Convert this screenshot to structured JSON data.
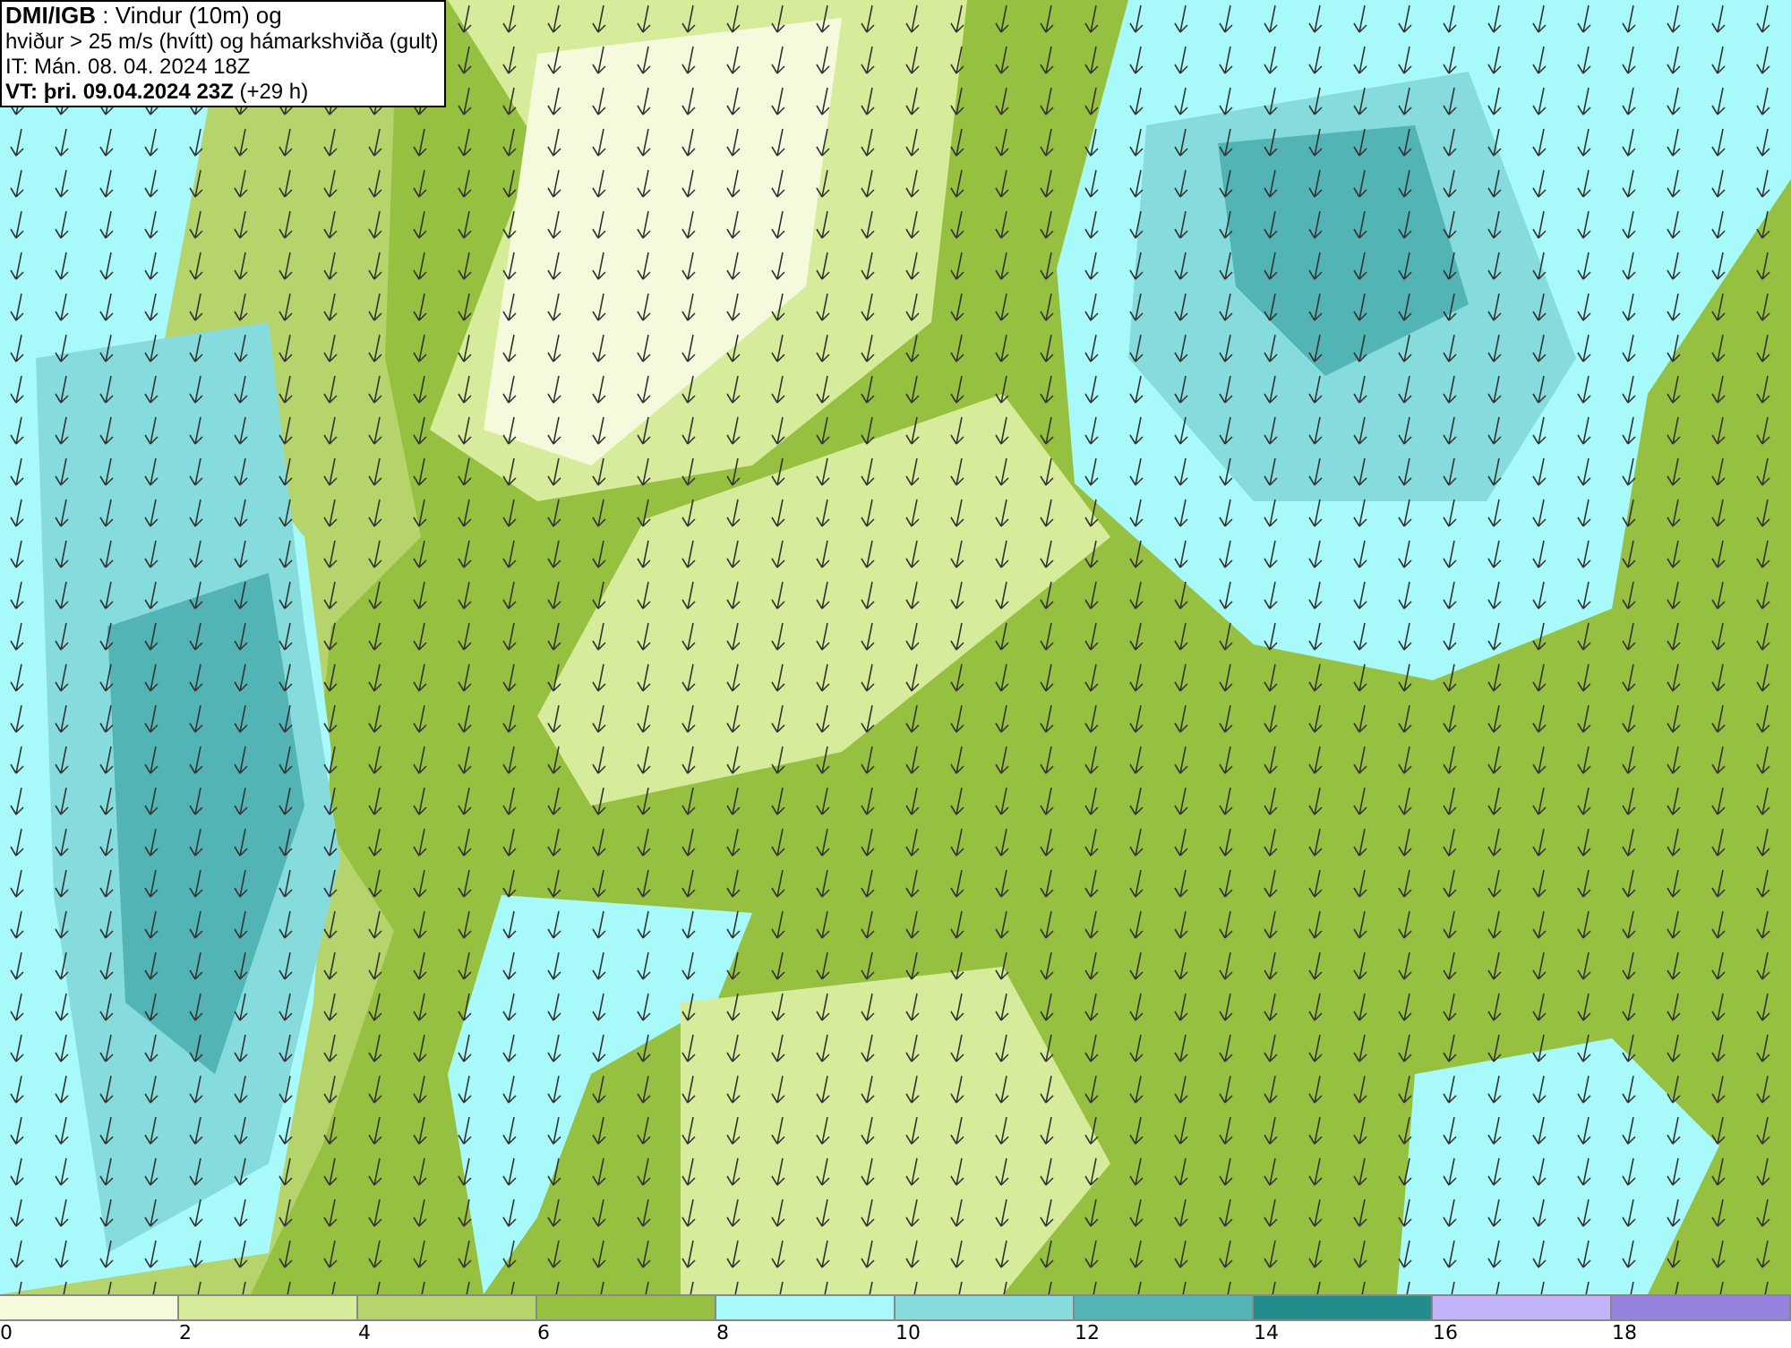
{
  "title_box": {
    "lines": [
      "**DMI/IGB** : Vindur (10m) og",
      "hviður > 25 m/s (hvítt) og hámarkshviða (gult)",
      "IT: Mán. 08. 04. 2024 18Z",
      "**VT: þri. 09.04.2024 23Z** (+29 h)"
    ]
  },
  "legend": [
    {
      "label": "0",
      "color": "#f5fadc"
    },
    {
      "label": "2",
      "color": "#d6ec9a"
    },
    {
      "label": "4",
      "color": "#b5d56c"
    },
    {
      "label": "6",
      "color": "#96c040"
    },
    {
      "label": "8",
      "color": "#a8fafa"
    },
    {
      "label": "10",
      "color": "#86dcdc"
    },
    {
      "label": "12",
      "color": "#52b4b4"
    },
    {
      "label": "14",
      "color": "#238c8c"
    },
    {
      "label": "16",
      "color": "#c3b4fa"
    },
    {
      "label": "18",
      "color": "#9682dc"
    }
  ]
}
